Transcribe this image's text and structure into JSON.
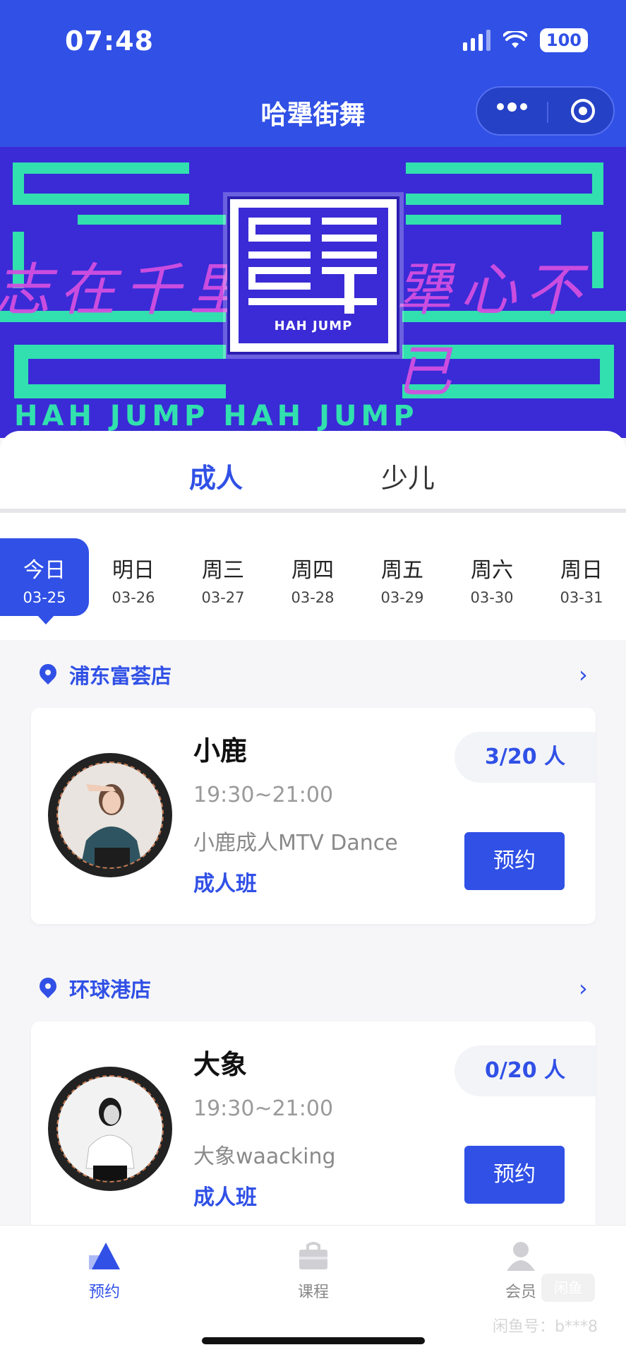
{
  "status_bar": {
    "time": "07:48",
    "battery": "100"
  },
  "header": {
    "title": "哈犟街舞"
  },
  "banner": {
    "slogan_left": "志在千里",
    "slogan_right": "犟心不已",
    "logo_text": "HAH JUMP",
    "bottom_text": "HAH JUMP HAH JUMP"
  },
  "tabs": [
    {
      "label": "成人",
      "active": true
    },
    {
      "label": "少儿",
      "active": false
    }
  ],
  "dates": [
    {
      "weekday": "今日",
      "date": "03-25",
      "active": true
    },
    {
      "weekday": "明日",
      "date": "03-26"
    },
    {
      "weekday": "周三",
      "date": "03-27"
    },
    {
      "weekday": "周四",
      "date": "03-28"
    },
    {
      "weekday": "周五",
      "date": "03-29"
    },
    {
      "weekday": "周六",
      "date": "03-30"
    },
    {
      "weekday": "周日",
      "date": "03-31"
    }
  ],
  "stores": [
    {
      "name": "浦东富荟店",
      "classes": [
        {
          "teacher": "小鹿",
          "time": "19:30~21:00",
          "name": "小鹿成人MTV Dance",
          "type": "成人班",
          "count": "3/20 人",
          "button": "预约"
        }
      ]
    },
    {
      "name": "环球港店",
      "classes": [
        {
          "teacher": "大象",
          "time": "19:30~21:00",
          "name": "大象waacking",
          "type": "成人班",
          "count": "0/20 人",
          "button": "预约"
        }
      ]
    }
  ],
  "bottom_nav": [
    {
      "label": "预约",
      "active": true,
      "icon": "booking-icon"
    },
    {
      "label": "课程",
      "active": false,
      "icon": "course-bag-icon"
    },
    {
      "label": "会员",
      "active": false,
      "icon": "member-icon"
    }
  ],
  "watermark": {
    "badge": "闲鱼",
    "text": "闲鱼号：b***8"
  },
  "colors": {
    "primary": "#3050e6",
    "banner_bg": "#3a2bd6",
    "banner_accent": "#31e0ae",
    "brush": "#d24fe0"
  }
}
